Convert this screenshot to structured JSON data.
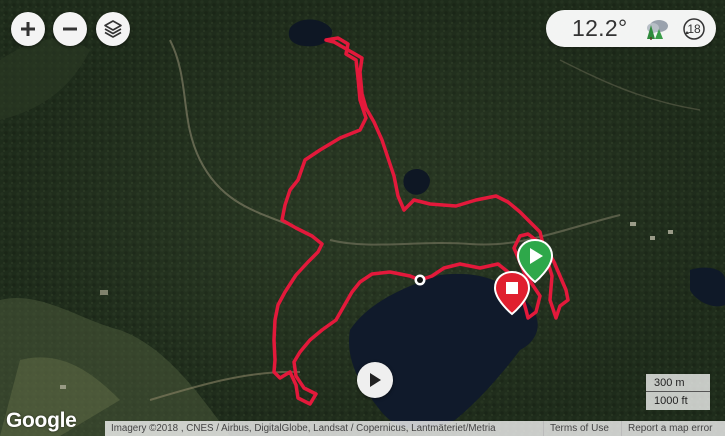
{
  "map": {
    "type": "satellite",
    "track_color": "#e3193b"
  },
  "controls": {
    "zoom_in_icon": "plus-icon",
    "zoom_out_icon": "minus-icon",
    "layers_icon": "layers-icon"
  },
  "weather": {
    "temperature": "12.2°",
    "condition_icon": "cloud-trees-icon",
    "day_badge": "18"
  },
  "markers": {
    "start_color": "#2ea84a",
    "start_icon": "play-triangle-icon",
    "end_color": "#e0202f",
    "end_icon": "stop-square-icon",
    "waypoint_icon": "dot-icon"
  },
  "playback": {
    "icon": "play-icon"
  },
  "footer": {
    "logo": "Google",
    "attribution": "Imagery ©2018 , CNES / Airbus, DigitalGlobe, Landsat / Copernicus, Lantmäteriet/Metria",
    "terms": "Terms of Use",
    "report": "Report a map error"
  },
  "scale": {
    "metric": "300 m",
    "imperial": "1000 ft"
  }
}
